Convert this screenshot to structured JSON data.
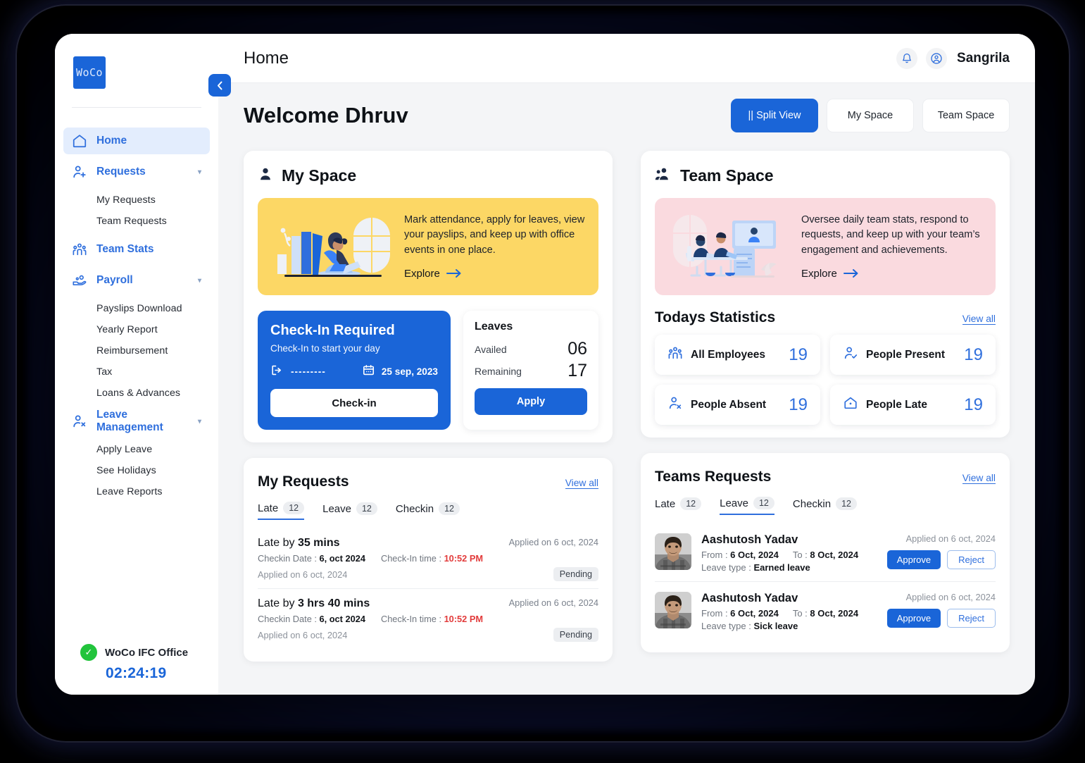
{
  "sidebar": {
    "logo_text": "WoCo",
    "collapse_icon": "chevron-left-icon",
    "items": [
      {
        "label": "Home",
        "icon": "home-icon",
        "active": true,
        "expandable": false
      },
      {
        "label": "Requests",
        "icon": "user-plus-icon",
        "active": false,
        "expandable": true,
        "children": [
          "My Requests",
          "Team Requests"
        ]
      },
      {
        "label": "Team Stats",
        "icon": "people-group-icon",
        "active": false,
        "expandable": false
      },
      {
        "label": "Payroll",
        "icon": "payroll-hand-icon",
        "active": false,
        "expandable": true,
        "children": [
          "Payslips Download",
          "Yearly Report",
          "Reimbursement",
          "Tax",
          "Loans & Advances"
        ]
      },
      {
        "label": "Leave Management",
        "icon": "user-x-icon",
        "active": false,
        "expandable": true,
        "children": [
          "Apply Leave",
          "See Holidays",
          "Leave Reports"
        ]
      }
    ],
    "office": {
      "status_icon": "check-circle-icon",
      "name": "WoCo IFC Office",
      "timer": "02:24:19"
    }
  },
  "topbar": {
    "title": "Home",
    "notification_icon": "bell-icon",
    "avatar_icon": "user-circle-icon",
    "user_name": "Sangrila"
  },
  "header": {
    "welcome": "Welcome Dhruv",
    "view_buttons": [
      {
        "label": "|| Split View",
        "active": true
      },
      {
        "label": "My Space",
        "active": false
      },
      {
        "label": "Team Space",
        "active": false
      }
    ]
  },
  "my_space": {
    "title": "My Space",
    "icon": "person-icon",
    "promo": {
      "text": "Mark attendance, apply for leaves, view your payslips, and keep up with office events in one place.",
      "cta": "Explore",
      "cta_icon": "arrow-right-icon",
      "bg_color": "#fcd765"
    },
    "checkin": {
      "title": "Check-In Required",
      "subtitle": "Check-In to start your day",
      "time_icon": "logout-icon",
      "time_value": "---------",
      "calendar_icon": "calendar-icon",
      "date": "25 sep, 2023",
      "button": "Check-in"
    },
    "leaves": {
      "title": "Leaves",
      "rows": [
        {
          "label": "Availed",
          "value": "06"
        },
        {
          "label": "Remaining",
          "value": "17"
        }
      ],
      "button": "Apply"
    },
    "requests": {
      "title": "My  Requests",
      "view_all": "View all",
      "tabs": [
        {
          "label": "Late",
          "count": "12",
          "active": true
        },
        {
          "label": "Leave",
          "count": "12",
          "active": false
        },
        {
          "label": "Checkin",
          "count": "12",
          "active": false
        }
      ],
      "items": [
        {
          "title_prefix": "Late by ",
          "title_value": "35 mins",
          "applied_top": "Applied on 6 oct, 2024",
          "checkin_date_label": "Checkin Date : ",
          "checkin_date": "6, oct 2024",
          "checkin_time_label": "Check-In time : ",
          "checkin_time": "10:52 PM",
          "applied_bottom": "Applied on 6 oct, 2024",
          "status": "Pending"
        },
        {
          "title_prefix": "Late by ",
          "title_value": "3 hrs 40 mins",
          "applied_top": "Applied on 6 oct, 2024",
          "checkin_date_label": "Checkin Date : ",
          "checkin_date": "6, oct 2024",
          "checkin_time_label": "Check-In time : ",
          "checkin_time": "10:52 PM",
          "applied_bottom": "Applied on 6 oct, 2024",
          "status": "Pending"
        }
      ]
    }
  },
  "team_space": {
    "title": "Team Space",
    "icon": "people-icon",
    "promo": {
      "text": "Oversee daily team stats, respond to requests, and keep up with your team’s engagement and achievements.",
      "cta": "Explore",
      "cta_icon": "arrow-right-icon",
      "bg_color": "#fadadf"
    },
    "stats": {
      "title": "Todays Statistics",
      "view_all": "View all",
      "cards": [
        {
          "label": "All Employees",
          "value": "19",
          "icon": "people-group-icon"
        },
        {
          "label": "People Present",
          "value": "19",
          "icon": "user-check-icon"
        },
        {
          "label": "People Absent",
          "value": "19",
          "icon": "user-x-icon"
        },
        {
          "label": "People Late",
          "value": "19",
          "icon": "home-dot-icon"
        }
      ]
    },
    "requests": {
      "title": "Teams  Requests",
      "view_all": "View all",
      "tabs": [
        {
          "label": "Late",
          "count": "12",
          "active": false
        },
        {
          "label": "Leave",
          "count": "12",
          "active": true
        },
        {
          "label": "Checkin",
          "count": "12",
          "active": false
        }
      ],
      "items": [
        {
          "name": "Aashutosh Yadav",
          "avatar": "employee-photo",
          "from_label": "From : ",
          "from_date": "6 Oct, 2024",
          "to_label": "To : ",
          "to_date": "8 Oct, 2024",
          "type_label": "Leave type : ",
          "type_value": "Earned leave",
          "applied": "Applied on 6 oct, 2024",
          "approve": "Approve",
          "reject": "Reject"
        },
        {
          "name": "Aashutosh Yadav",
          "avatar": "employee-photo",
          "from_label": "From : ",
          "from_date": "6 Oct, 2024",
          "to_label": "To : ",
          "to_date": "8 Oct, 2024",
          "type_label": "Leave type : ",
          "type_value": "Sick leave",
          "applied": "Applied on 6 oct, 2024",
          "approve": "Approve",
          "reject": "Reject"
        }
      ]
    }
  },
  "colors": {
    "primary": "#1a65d8",
    "primary_text": "#2f6fdd",
    "yellow": "#fcd765",
    "pink": "#fadadf",
    "danger": "#e23b3b",
    "success": "#22c43c",
    "page_bg": "#f4f5f7"
  }
}
